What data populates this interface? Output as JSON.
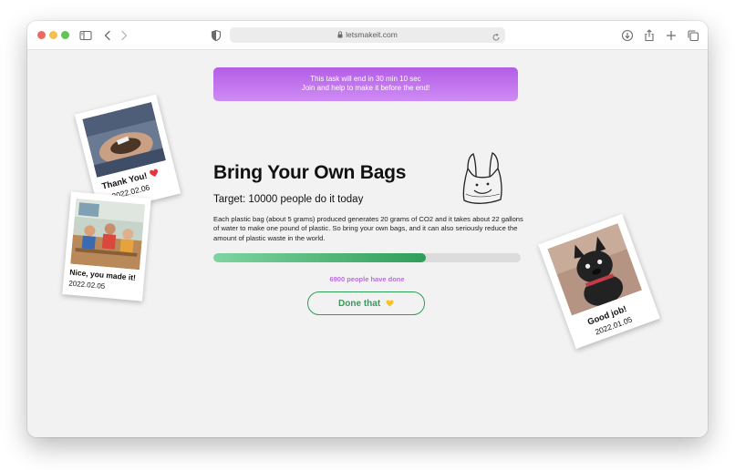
{
  "browser": {
    "url": "letsmakeit.com"
  },
  "banner": {
    "line1": "This task will end in 30 min 10 sec",
    "line2": "Join and help to make it before the end!"
  },
  "task": {
    "title": "Bring Your Own Bags",
    "target": "Target: 10000 people do it today",
    "description": "Each plastic bag (about 5 grams) produced generates 20 grams of CO2 and it takes about 22 gallons of water to make one pound of plastic. So bring your own bags, and it can also seriously reduce the amount of plastic waste in the world.",
    "progress_fraction": 0.69,
    "done_count_text": "6900 people have done",
    "done_button_label": "Done that"
  },
  "polaroids": [
    {
      "caption": "Thank You!",
      "date": "2022.02.06",
      "icon": "red-heart-icon"
    },
    {
      "caption": "Nice, you made it!",
      "date": "2022.02.05"
    },
    {
      "caption": "Good job!",
      "date": "2022.01.05"
    }
  ],
  "colors": {
    "banner_purple": "#b35de6",
    "progress_green": "#2f9e59",
    "done_count_purple": "#b86ee0",
    "heart_red": "#e8323c",
    "heart_yellow": "#f2c230"
  }
}
